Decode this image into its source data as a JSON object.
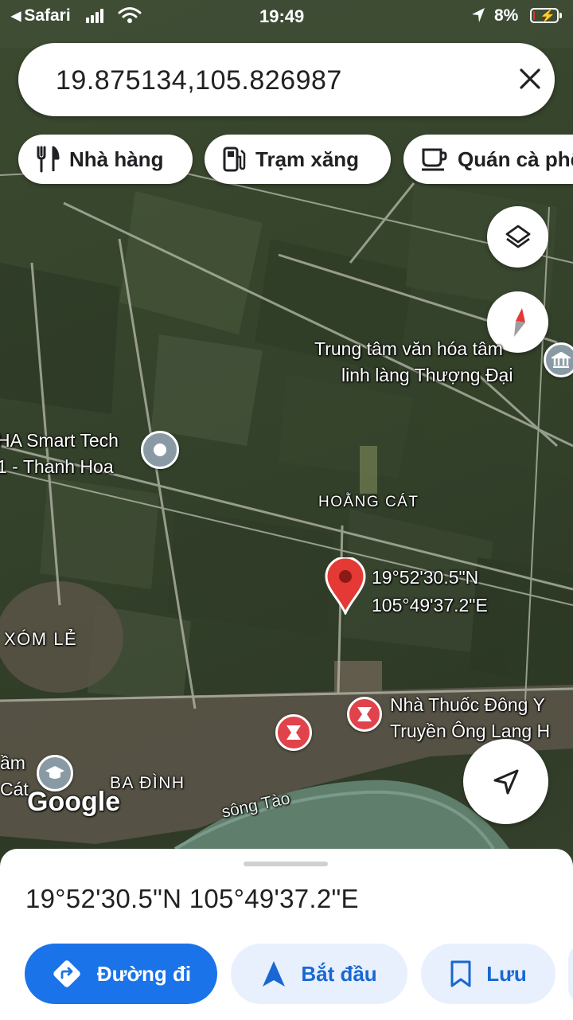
{
  "status_bar": {
    "back_app": "Safari",
    "time": "19:49",
    "battery_percent": "8%",
    "battery_level": 0.08
  },
  "search": {
    "query": "19.875134,105.826987"
  },
  "chips": [
    {
      "label": "Nhà hàng",
      "icon": "fork-knife-icon"
    },
    {
      "label": "Trạm xăng",
      "icon": "gas-pump-icon"
    },
    {
      "label": "Quán cà phê",
      "icon": "coffee-cup-icon"
    }
  ],
  "map": {
    "labels": {
      "culture_center_line1": "Trung tâm văn hóa tâm",
      "culture_center_line2": "linh làng Thượng Đại",
      "smart_tech_line1": "HA Smart Tech",
      "smart_tech_line2": "1 - Thanh Hoa",
      "hoang_cat": "HOẰNG CÁT",
      "pin_lat": "19°52'30.5\"N",
      "pin_lng": "105°49'37.2\"E",
      "xom_le": "XÓM LẺ",
      "pharmacy_line1": "Nhà Thuốc Đông Y",
      "pharmacy_line2": "Truyền Ông Lang H",
      "school_line1": "ầm",
      "school_line2": "Cát",
      "ba_dinh": "BA ĐÌNH",
      "river": "sông Tào",
      "google": "Google"
    },
    "colors": {
      "pin": "#e53935",
      "pharmacy": "#e0434b",
      "poi_grey": "#8a9aa5",
      "accent_blue": "#1a73e8"
    }
  },
  "sheet": {
    "coords": "19°52'30.5\"N 105°49'37.2\"E",
    "actions": [
      {
        "label": "Đường đi",
        "icon": "directions-icon"
      },
      {
        "label": "Bắt đầu",
        "icon": "navigation-arrow-icon"
      },
      {
        "label": "Lưu",
        "icon": "bookmark-icon"
      }
    ]
  }
}
